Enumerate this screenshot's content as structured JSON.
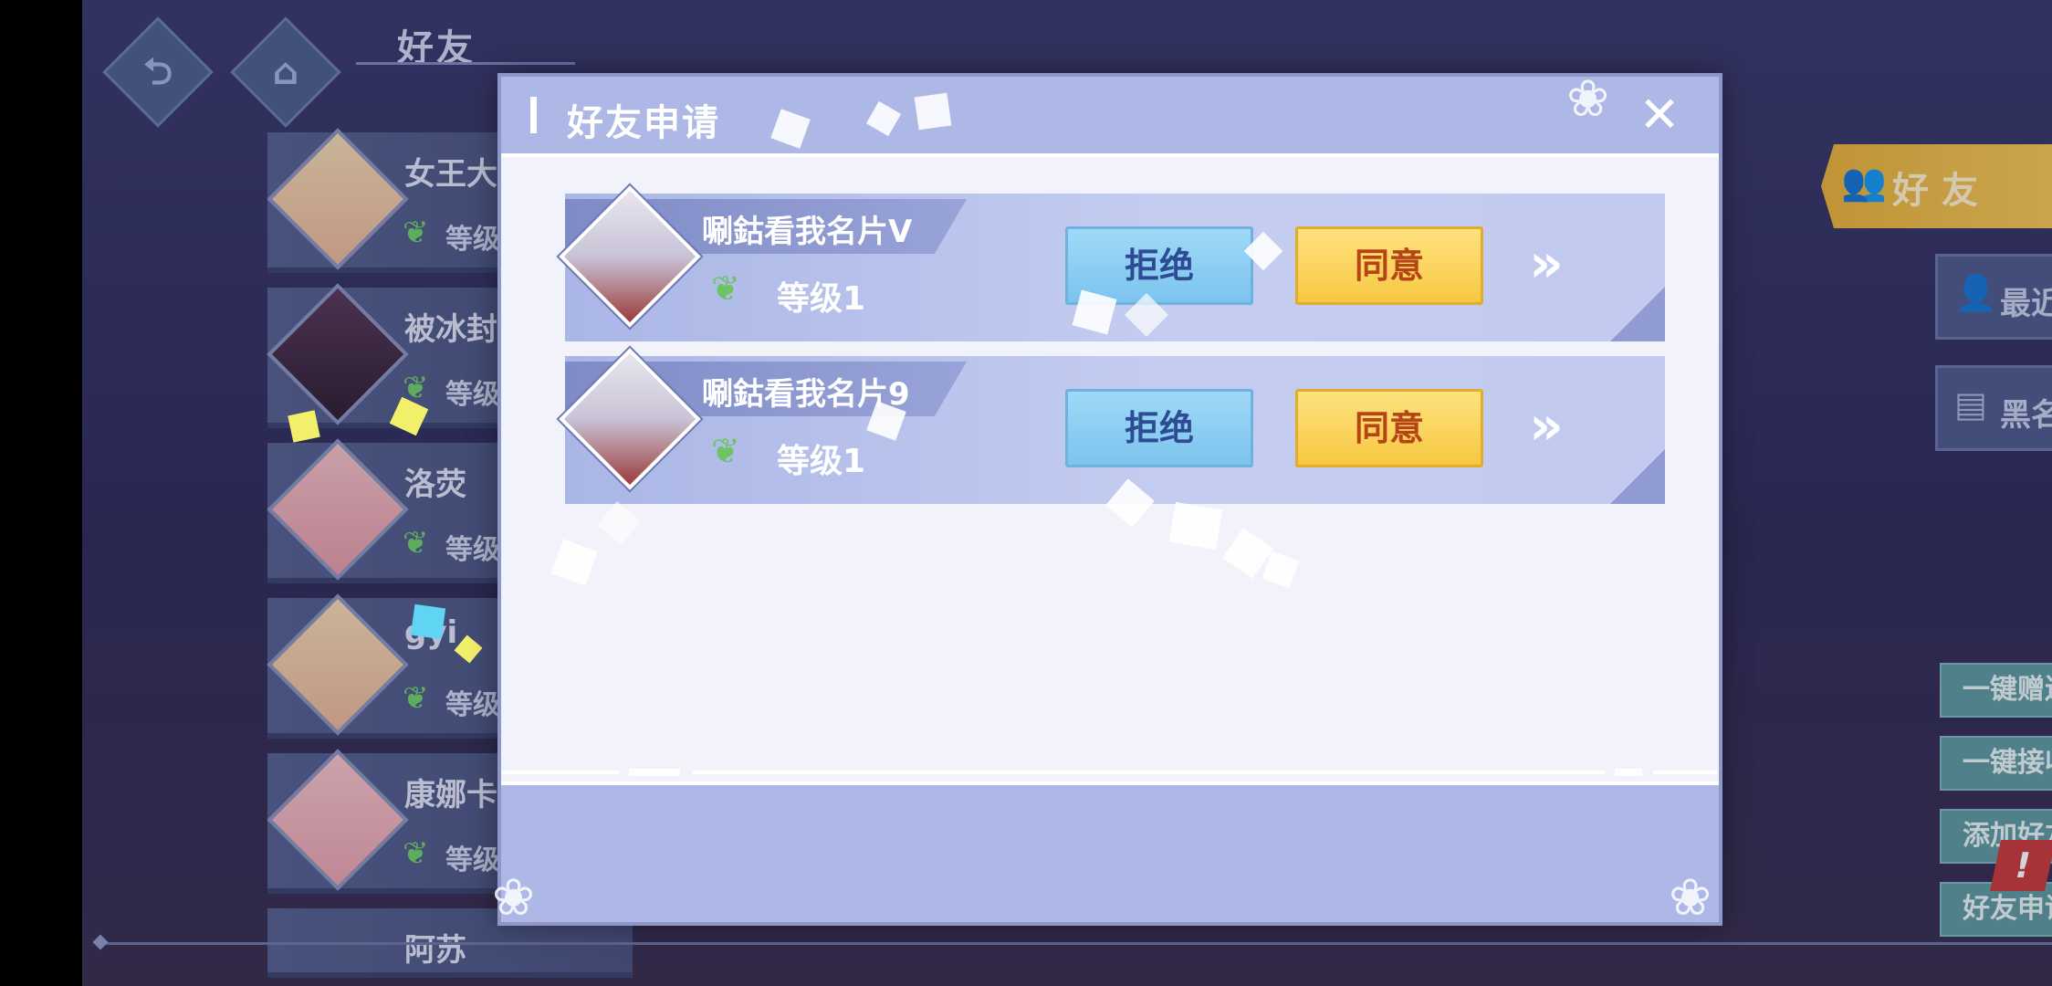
{
  "header": {
    "title": "好友"
  },
  "friends": [
    {
      "name": "女王大",
      "level": "等级"
    },
    {
      "name": "被冰封",
      "level": "等级"
    },
    {
      "name": "洛荧",
      "level": "等级"
    },
    {
      "name": "gyi",
      "level": "等级"
    },
    {
      "name": "康娜卡",
      "level": "等级"
    },
    {
      "name": "阿苏"
    }
  ],
  "sidebar": {
    "tab_friends": "好友",
    "tab_recent": "最近玩伴",
    "tab_blacklist": "黑名单"
  },
  "actions": {
    "send_all": "一键赠送",
    "receive_all": "一键接收",
    "add_friend": "添加好友",
    "friend_requests": "好友申请",
    "alert": "!"
  },
  "dialog": {
    "title": "好友申请",
    "close": "✕",
    "requests": [
      {
        "name": "唰鈷看我名片V",
        "level": "等级1",
        "reject": "拒绝",
        "accept": "同意",
        "more": "»"
      },
      {
        "name": "唰鈷看我名片9",
        "level": "等级1",
        "reject": "拒绝",
        "accept": "同意",
        "more": "»"
      }
    ]
  },
  "icons": {
    "back": "back-icon",
    "home": "home-icon",
    "leaf": "leaf-icon",
    "friends": "friends-icon",
    "recent": "recent-players-icon",
    "blacklist": "blacklist-icon"
  },
  "colors": {
    "dialog_header": "#aeb8e6",
    "reject_button": "#8fd0f4",
    "accept_button": "#f9d65c",
    "friends_tab": "#f0bf4f"
  }
}
